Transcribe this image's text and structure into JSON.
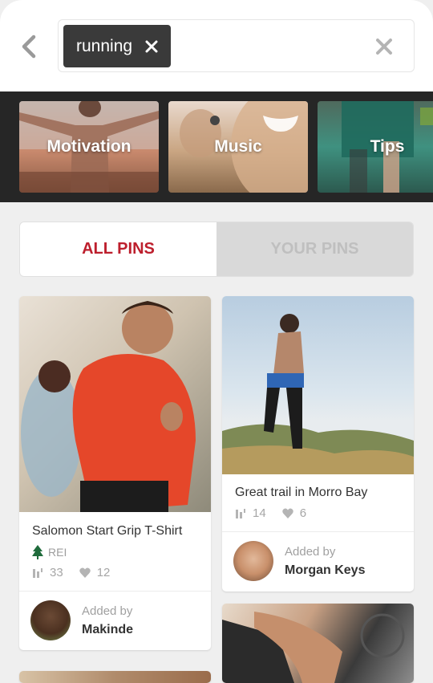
{
  "search": {
    "chip_label": "running"
  },
  "categories": [
    "Motivation",
    "Music",
    "Tips"
  ],
  "tabs": {
    "all_pins": "ALL PINS",
    "your_pins": "YOUR PINS"
  },
  "pins": [
    {
      "title": "Salomon Start Grip T-Shirt",
      "source": "REI",
      "repins": "33",
      "likes": "12",
      "added_by_label": "Added by",
      "user": "Makinde"
    },
    {
      "title": "Great trail in Morro Bay",
      "repins": "14",
      "likes": "6",
      "added_by_label": "Added by",
      "user": "Morgan Keys"
    }
  ],
  "colors": {
    "accent": "#bd1f2d",
    "chip": "#3a3a3a",
    "strip": "#262626"
  },
  "icons": [
    "back-icon",
    "close-icon",
    "repin-icon",
    "heart-icon",
    "tree-icon"
  ]
}
